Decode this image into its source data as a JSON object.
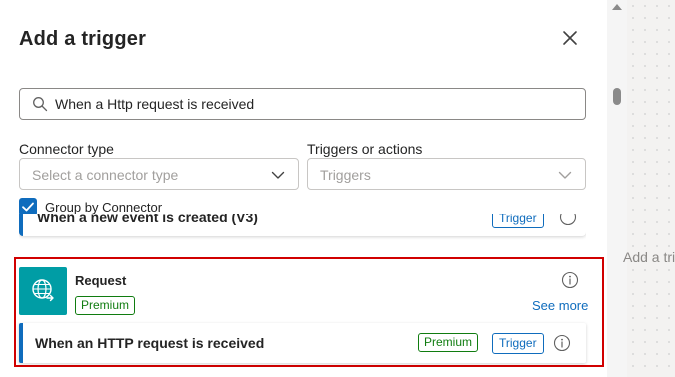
{
  "panel": {
    "title": "Add a trigger",
    "close_icon": "close-icon"
  },
  "search": {
    "icon": "search-icon",
    "value": "When a Http request is received"
  },
  "filters": {
    "connector_type": {
      "label": "Connector type",
      "placeholder": "Select a connector type"
    },
    "triggers_or_actions": {
      "label": "Triggers or actions",
      "placeholder": "Triggers"
    }
  },
  "group_by_connector": {
    "label": "Group by Connector",
    "checked": true
  },
  "previous_item": {
    "text": "When a new event is created (V3)",
    "badge": "Trigger"
  },
  "connector": {
    "name": "Request",
    "badge": "Premium",
    "see_more": "See more",
    "icon": "globe-request-icon",
    "icon_color": "#009da5"
  },
  "action": {
    "label": "When an HTTP request is received",
    "premium_badge": "Premium",
    "trigger_badge": "Trigger"
  },
  "canvas": {
    "hint_text": "Add a trigger"
  },
  "colors": {
    "accent": "#0f6cbd",
    "premium": "#107c10",
    "highlight_border": "#d10000"
  }
}
